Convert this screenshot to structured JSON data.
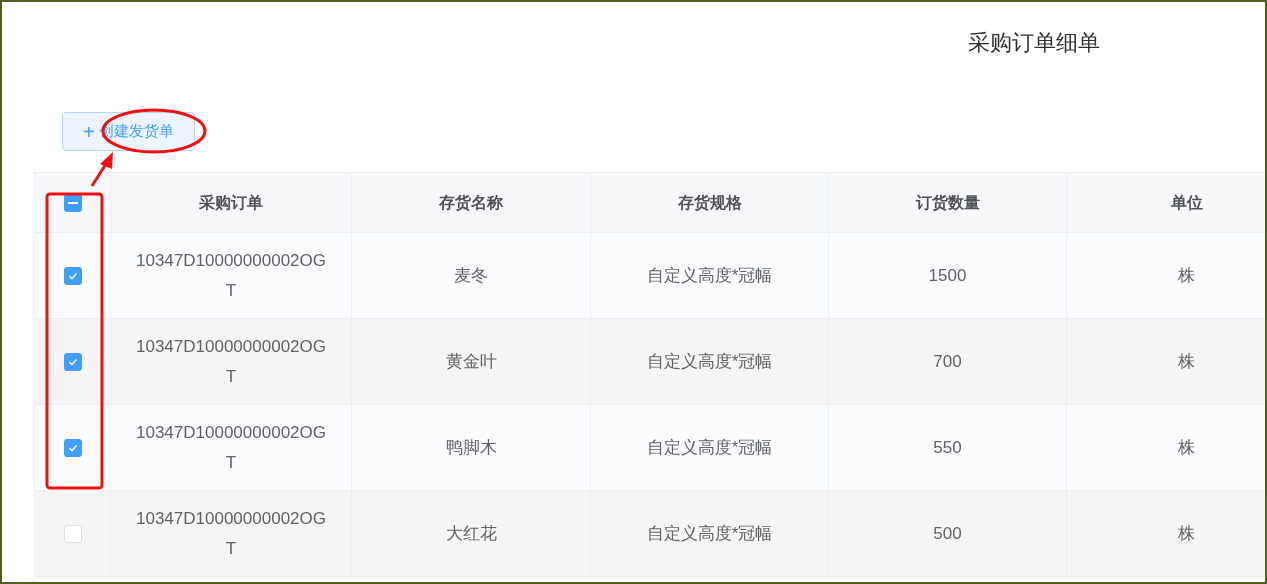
{
  "title": "采购订单细单",
  "create_button": {
    "icon": "+",
    "label": "创建发货单"
  },
  "table": {
    "header_checkbox": {
      "indeterminate": true
    },
    "columns": [
      "采购订单",
      "存货名称",
      "存货规格",
      "订货数量",
      "单位"
    ],
    "rows": [
      {
        "selected": true,
        "cells": [
          "10347D10000000002OGT",
          "麦冬",
          "自定义高度*冠幅",
          "1500",
          "株"
        ]
      },
      {
        "selected": true,
        "cells": [
          "10347D10000000002OGT",
          "黄金叶",
          "自定义高度*冠幅",
          "700",
          "株"
        ]
      },
      {
        "selected": true,
        "cells": [
          "10347D10000000002OGT",
          "鸭脚木",
          "自定义高度*冠幅",
          "550",
          "株"
        ]
      },
      {
        "selected": false,
        "cells": [
          "10347D10000000002OGT",
          "大红花",
          "自定义高度*冠幅",
          "500",
          "株"
        ]
      }
    ]
  }
}
